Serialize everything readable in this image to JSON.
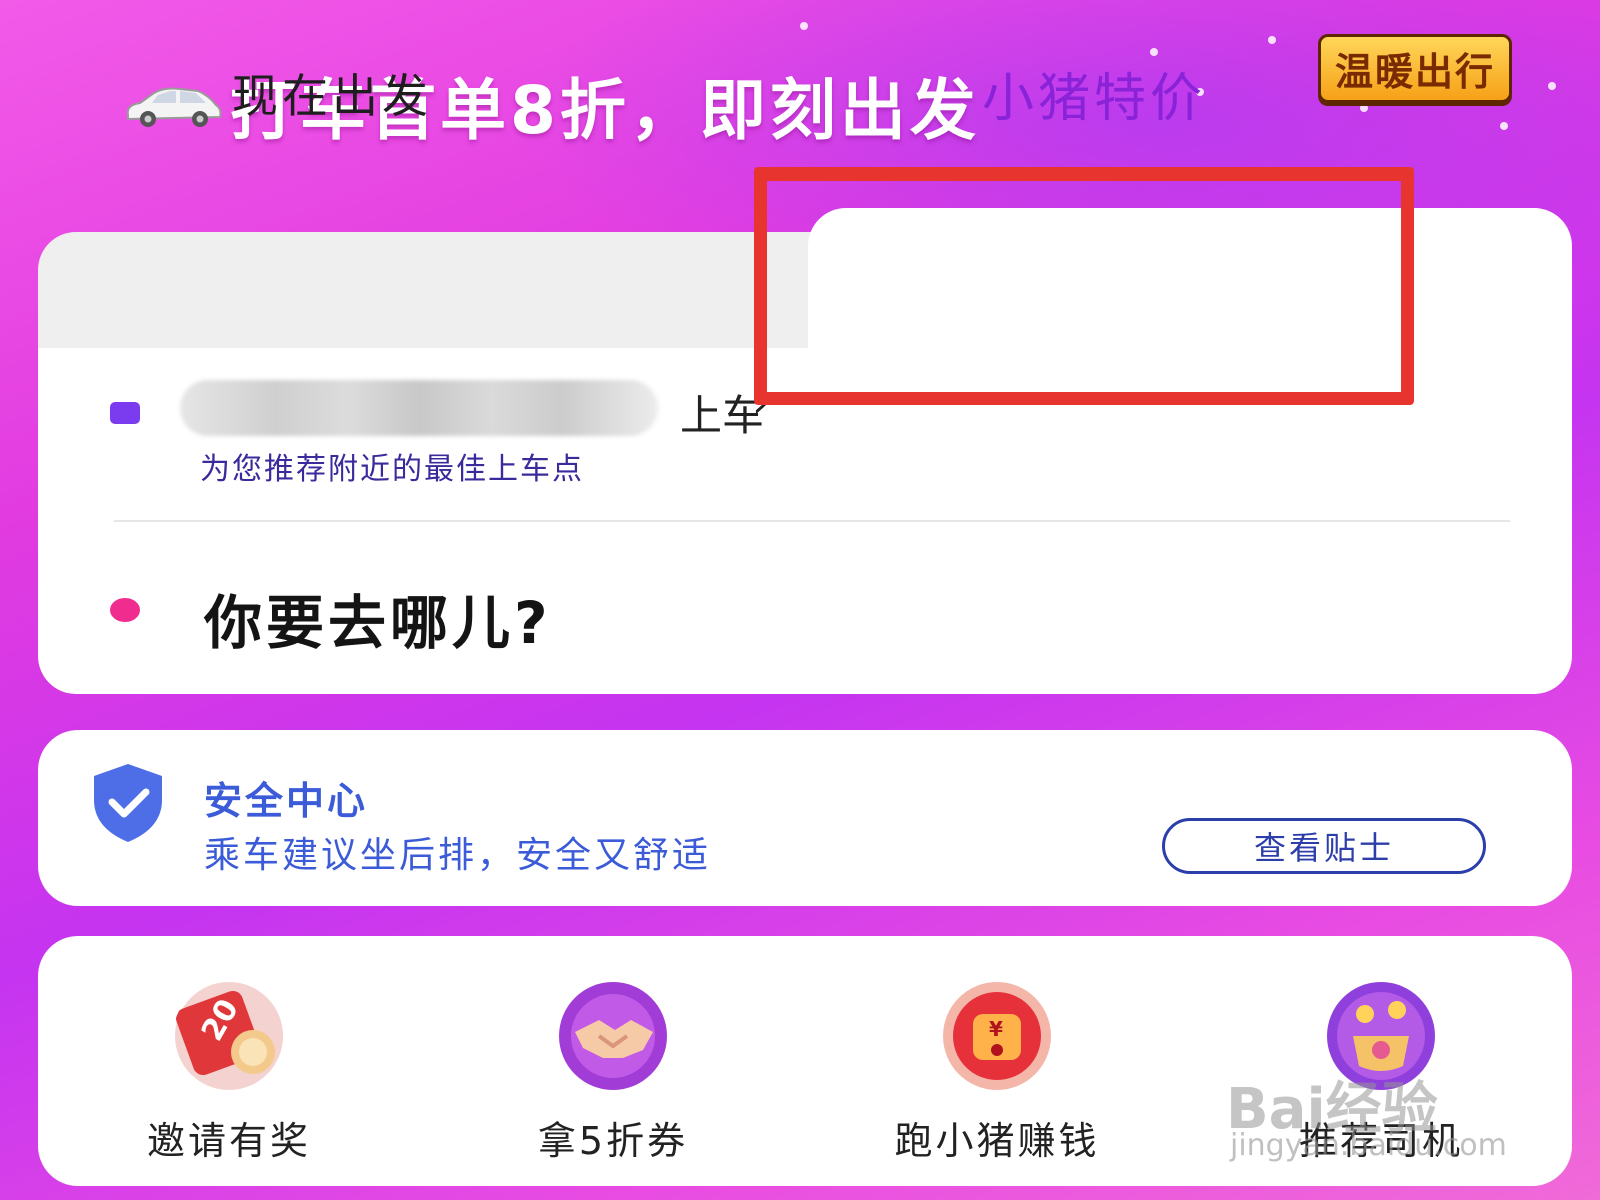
{
  "banner": {
    "headline": "打车首单8折，即刻出发",
    "badge": "温暖出行"
  },
  "tabs": [
    {
      "label": "现在出发",
      "selected": false
    },
    {
      "label": "小猪特价",
      "selected": true
    }
  ],
  "pickup": {
    "suffix": "上车",
    "arrow": "›",
    "hint": "为您推荐附近的最佳上车点"
  },
  "destination": {
    "prompt": "你要去哪儿?"
  },
  "safety": {
    "title": "安全中心",
    "subtitle": "乘车建议坐后排，安全又舒适",
    "button_label": "查看贴士"
  },
  "services": [
    {
      "label": "邀请有奖",
      "icon": "gift-coupon-icon"
    },
    {
      "label": "拿5折券",
      "icon": "handshake-icon"
    },
    {
      "label": "跑小猪赚钱",
      "icon": "money-bag-icon"
    },
    {
      "label": "推荐司机",
      "icon": "gold-pot-icon"
    }
  ],
  "watermark": {
    "brand": "Bai经验",
    "url": "jingyan.baidu.com"
  },
  "colors": {
    "accent_purple": "#8a22d8",
    "safety_blue": "#3b5bd8",
    "highlight_red": "#e8342f",
    "destination_dot": "#f12c8f",
    "pickup_dot": "#7b3cf0"
  }
}
